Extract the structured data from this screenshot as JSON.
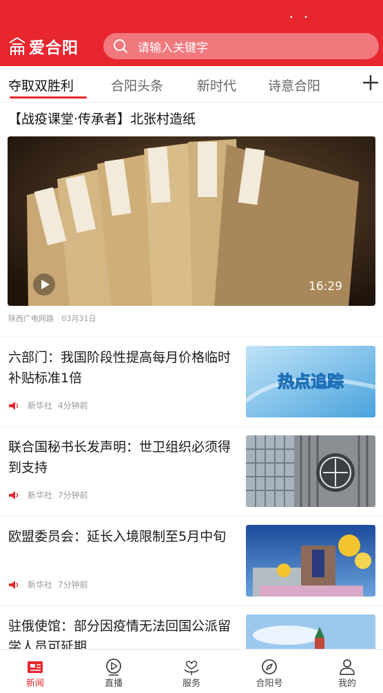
{
  "app": {
    "logo_text": "爱合阳",
    "brand_color": "#e8262e"
  },
  "search": {
    "placeholder": "请输入关键字"
  },
  "tabs": [
    {
      "label": "夺取双胜利",
      "active": true
    },
    {
      "label": "合阳头条",
      "active": false
    },
    {
      "label": "新时代",
      "active": false
    },
    {
      "label": "诗意合阳",
      "active": false
    }
  ],
  "feature": {
    "title": "【战疫课堂·传承者】北张村造纸",
    "duration": "16:29",
    "source": "陕西广电网路",
    "date": "03月31日"
  },
  "news": [
    {
      "title": "六部门：我国阶段性提高每月价格临时补贴标准1倍",
      "source": "新华社",
      "time": "4分钟前",
      "thumb_text": "热点追踪"
    },
    {
      "title": "联合国秘书长发声明：世卫组织必须得到支持",
      "source": "新华社",
      "time": "7分钟前"
    },
    {
      "title": "欧盟委员会：延长入境限制至5月中旬",
      "source": "新华社",
      "time": "7分钟前"
    },
    {
      "title": "驻俄使馆：部分因疫情无法回国公派留学人员可延期",
      "source": "",
      "time": ""
    }
  ],
  "bottom_nav": [
    {
      "label": "新闻",
      "icon": "news-icon",
      "active": true
    },
    {
      "label": "直播",
      "icon": "live-icon",
      "active": false
    },
    {
      "label": "服务",
      "icon": "service-icon",
      "active": false
    },
    {
      "label": "合阳号",
      "icon": "compass-icon",
      "active": false
    },
    {
      "label": "我的",
      "icon": "user-icon",
      "active": false
    }
  ]
}
